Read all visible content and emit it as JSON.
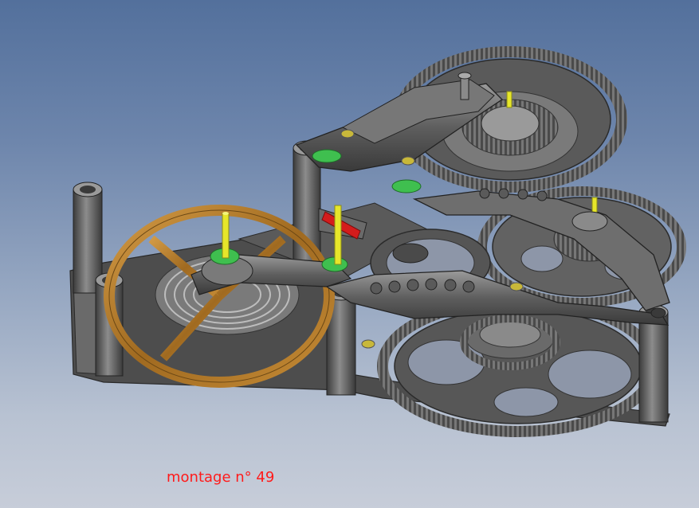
{
  "caption": "montage n° 49",
  "colors": {
    "background_top": "#53709c",
    "background_bottom": "#c7cdd9",
    "metal": "#5c5c5c",
    "metal_dark": "#3a3a3a",
    "metal_light": "#8a8a8a",
    "balance_gold": "#b07a2a",
    "pin_yellow": "#e6e62a",
    "bushing_green": "#3fbf4f",
    "lever_red": "#d41c1c",
    "caption_red": "#ff1a1a"
  },
  "icons": [
    "balance-wheel",
    "hairspring",
    "gear-train",
    "bridge",
    "pillar",
    "screw"
  ]
}
